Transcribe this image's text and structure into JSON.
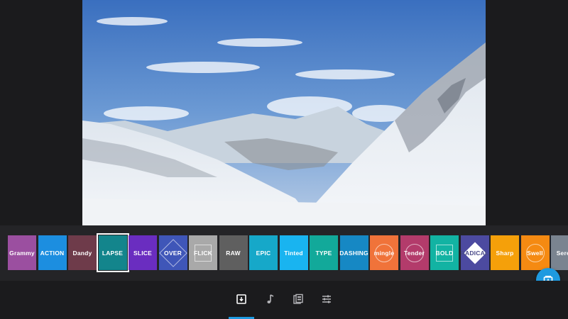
{
  "preview": {
    "image": "snowy-mountain-valley"
  },
  "filters": [
    {
      "label": "Grammy",
      "color": "#9b4fa0"
    },
    {
      "label": "ACTION",
      "color": "#1c8ee0"
    },
    {
      "label": "Dandy",
      "color": "#6e3b4a"
    },
    {
      "label": "LAPSE",
      "color": "#13858c",
      "selected": true
    },
    {
      "label": "SLICE",
      "color": "#6a2dc0"
    },
    {
      "label": "OVER",
      "color": "#3f56b8"
    },
    {
      "label": "FLICK",
      "color": "#a9a9a9"
    },
    {
      "label": "RAW",
      "color": "#5f5f5f"
    },
    {
      "label": "EPIC",
      "color": "#16a8c9"
    },
    {
      "label": "Tinted",
      "color": "#19b4f0"
    },
    {
      "label": "TYPE",
      "color": "#12a99a"
    },
    {
      "label": "DASHING",
      "color": "#1688c4"
    },
    {
      "label": "mingle",
      "color": "#f0733a"
    },
    {
      "label": "Tender",
      "color": "#b33b6b"
    },
    {
      "label": "BOLD",
      "color": "#12b3a3"
    },
    {
      "label": "RADICAL",
      "color": "#4c4aa0"
    },
    {
      "label": "Sharp",
      "color": "#f5a00a"
    },
    {
      "label": "Swell",
      "color": "#f58a12"
    },
    {
      "label": "Seren",
      "color": "#7a8490"
    }
  ],
  "nav": {
    "items": [
      {
        "icon": "filter-icon",
        "active": true
      },
      {
        "icon": "music-note-icon",
        "active": false
      },
      {
        "icon": "clip-icon",
        "active": false
      },
      {
        "icon": "sliders-icon",
        "active": false
      }
    ]
  },
  "fab": {
    "icon": "export-icon"
  },
  "colors": {
    "accent": "#1e9ae0",
    "background": "#1b1b1d",
    "strip": "#242427"
  }
}
